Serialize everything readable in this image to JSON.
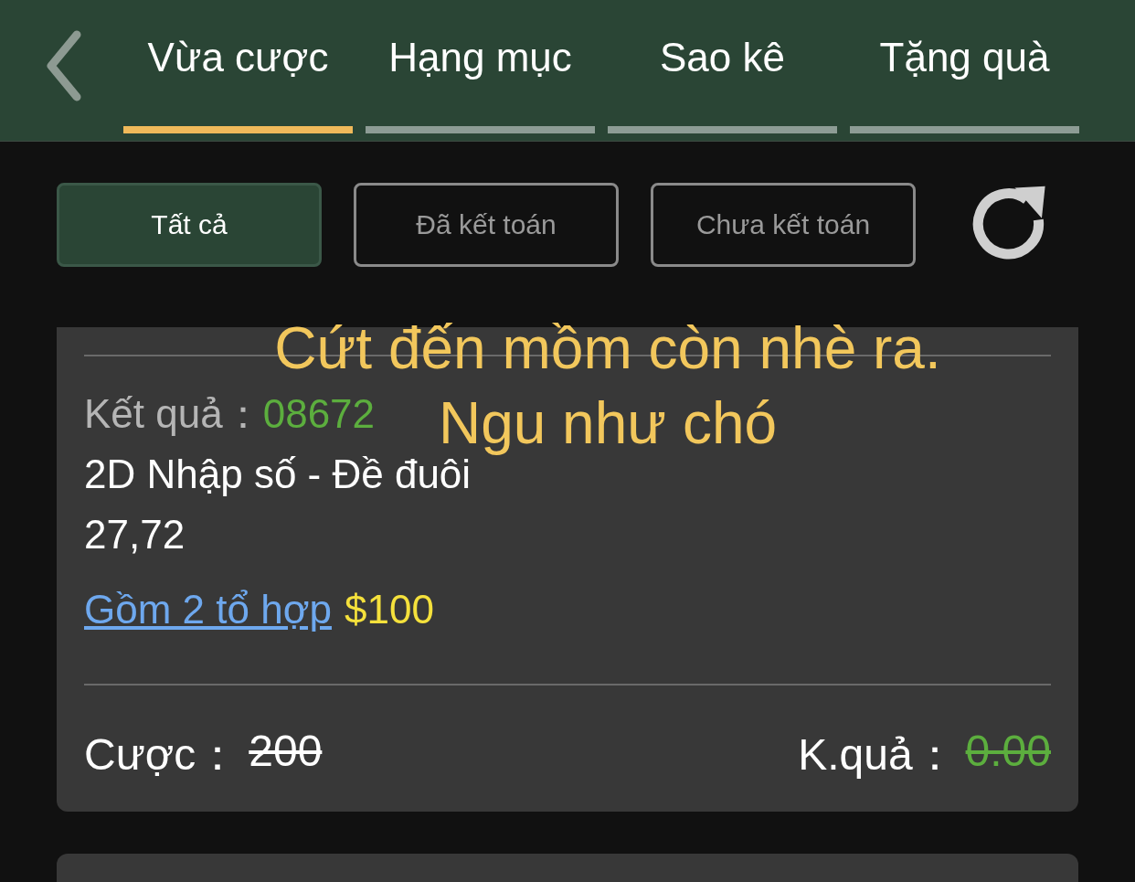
{
  "tabs": [
    {
      "label": "Vừa cược",
      "selected": true
    },
    {
      "label": "Hạng mục",
      "selected": false
    },
    {
      "label": "Sao kê",
      "selected": false
    },
    {
      "label": "Tặng quà",
      "selected": false
    }
  ],
  "filters": [
    {
      "label": "Tất cả",
      "selected": true
    },
    {
      "label": "Đã kết toán",
      "selected": false
    },
    {
      "label": "Chưa kết toán",
      "selected": false
    }
  ],
  "bet_card": {
    "result_label": "Kết quả：",
    "result_number": "08672",
    "game": "2D Nhập số - Đề đuôi",
    "numbers": "27,72",
    "combo_link": "Gồm 2 tổ hợp",
    "combo_amount": "$100",
    "stake": {
      "label": "Cược：",
      "value": "200",
      "struck": true
    },
    "payout": {
      "label": "K.quả：",
      "value": "0.00",
      "struck": true
    }
  },
  "overlay_caption": [
    "Cứt đến mồm còn nhè ra.",
    "Ngu như chó"
  ]
}
